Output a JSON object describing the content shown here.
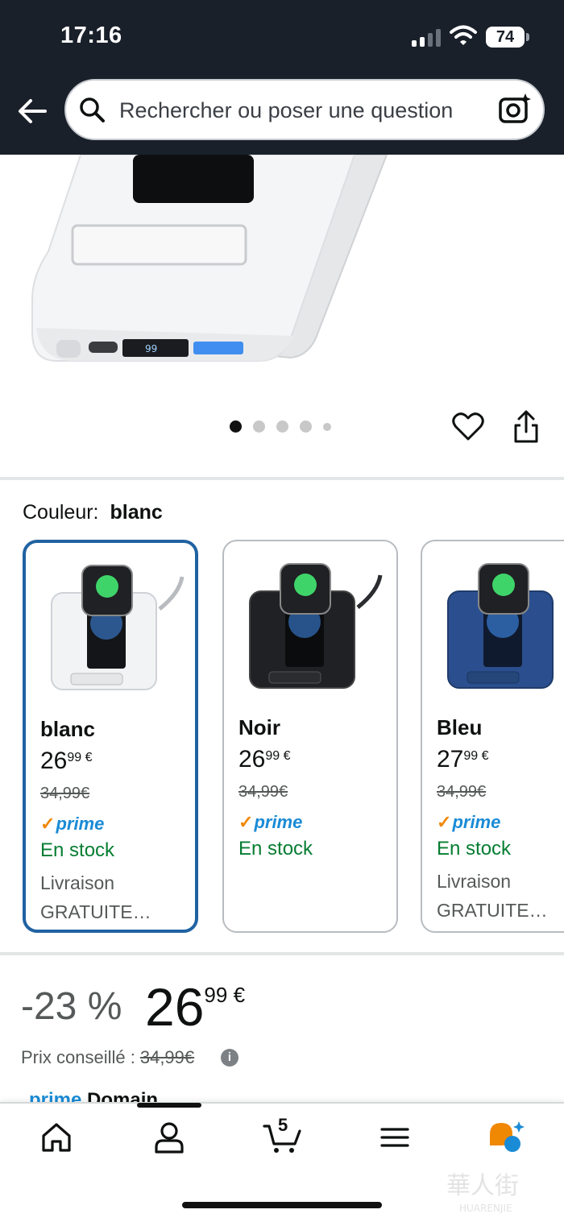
{
  "status_bar": {
    "time": "17:16",
    "battery": "74"
  },
  "search": {
    "placeholder": "Rechercher ou poser une question"
  },
  "gallery": {
    "dot_count": 5,
    "active_index": 0
  },
  "colour": {
    "label": "Couleur:",
    "selected": "blanc",
    "options": [
      {
        "name": "blanc",
        "price_whole": "26",
        "price_fraction": "99",
        "currency": "€",
        "old_price": "34,99€",
        "prime": "prime",
        "stock": "En stock",
        "delivery": "Livraison GRATUITE…",
        "body_color": "#f2f3f4"
      },
      {
        "name": "Noir",
        "price_whole": "26",
        "price_fraction": "99",
        "currency": "€",
        "old_price": "34,99€",
        "prime": "prime",
        "stock": "En stock",
        "delivery": "",
        "body_color": "#1f2124"
      },
      {
        "name": "Bleu",
        "price_whole": "27",
        "price_fraction": "99",
        "currency": "€",
        "old_price": "34,99€",
        "prime": "prime",
        "stock": "En stock",
        "delivery": "Livraison GRATUITE…",
        "body_color": "#2b4f8e"
      }
    ]
  },
  "price": {
    "discount": "-23 %",
    "whole": "26",
    "fraction": "99",
    "currency": "€",
    "rrp_label": "Prix conseillé :",
    "rrp_value": "34,99€",
    "info": "i"
  },
  "prime_day": {
    "prime": "prime",
    "label": "Domain"
  },
  "bottom_nav": {
    "cart_count": "5",
    "items": [
      "home-icon",
      "account-icon",
      "cart-icon",
      "menu-icon",
      "rufus-icon"
    ]
  },
  "colors": {
    "header_bg": "#1a202a",
    "selected_border": "#2162a1",
    "prime_blue": "#1a8bd6",
    "stock_green": "#067d32",
    "orange": "#f08804"
  }
}
